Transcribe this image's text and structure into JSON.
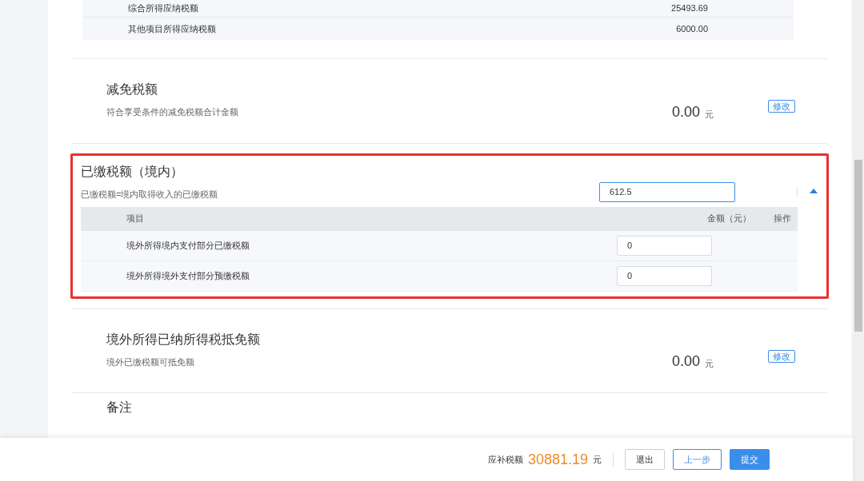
{
  "tax_table": {
    "rows": [
      {
        "label": "综合所得应纳税额",
        "value": "25493.69"
      },
      {
        "label": "其他项目所得应纳税额",
        "value": "6000.00"
      }
    ]
  },
  "sections": [
    {
      "kind": "amount",
      "title": "减免税额",
      "description": "符合享受条件的减免税额合计金额",
      "amount": "0.00",
      "unit": "元",
      "action": "修改"
    },
    {
      "kind": "detail",
      "highlighted": true,
      "expanded": true,
      "title": "已缴税额（境内）",
      "description": "已缴税额=境内取得收入的已缴税额",
      "value": "612.5",
      "columns": [
        "项目",
        "金额（元）",
        "操作"
      ],
      "rows": [
        {
          "label": "境外所得境内支付部分已缴税额",
          "value": "0"
        },
        {
          "label": "境外所得境外支付部分预缴税额",
          "value": "0"
        }
      ]
    },
    {
      "kind": "amount",
      "title": "境外所得已纳所得税抵免额",
      "description": "境外已缴税额可抵免额",
      "amount": "0.00",
      "unit": "元",
      "action": "修改"
    },
    {
      "kind": "heading",
      "title": "备注"
    }
  ],
  "footer": {
    "label": "应补税额",
    "amount": "30881.19",
    "unit": "元",
    "buttons": [
      {
        "label": "退出",
        "kind": "default"
      },
      {
        "label": "上一步",
        "kind": "outline"
      },
      {
        "label": "提交",
        "kind": "primary"
      }
    ]
  }
}
